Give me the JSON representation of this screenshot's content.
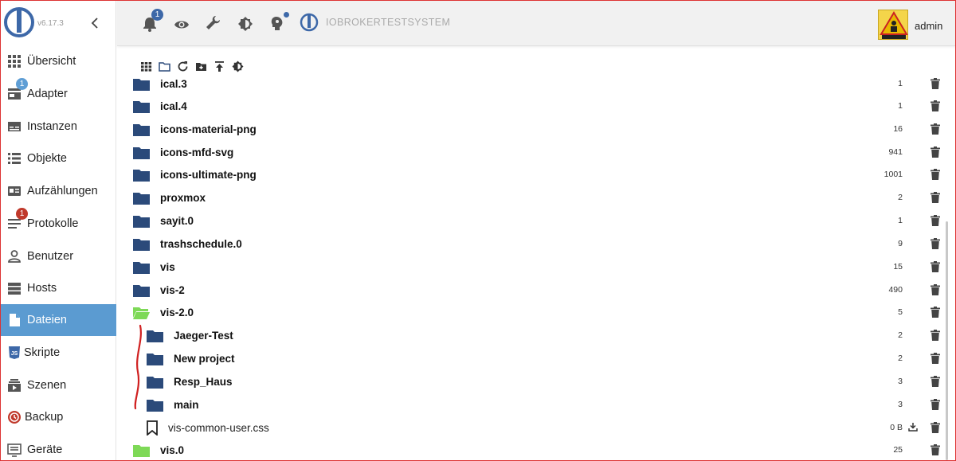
{
  "app": {
    "version": "v6.17.3",
    "system_title": "IOBROKERTESTSYSTEM",
    "user": "admin",
    "notification_count": "1"
  },
  "colors": {
    "accent": "#5b9bd1",
    "folder": "#2b4a7a",
    "folder_open": "#7ed957",
    "badge_blue": "#5f9ed5",
    "badge_red": "#c0392b"
  },
  "sidebar": {
    "items": [
      {
        "label": "Übersicht",
        "icon": "grid-icon"
      },
      {
        "label": "Adapter",
        "icon": "store-icon",
        "badge": "1"
      },
      {
        "label": "Instanzen",
        "icon": "instances-icon"
      },
      {
        "label": "Objekte",
        "icon": "list-icon"
      },
      {
        "label": "Aufzählungen",
        "icon": "enum-icon"
      },
      {
        "label": "Protokolle",
        "icon": "log-icon",
        "badge": "1"
      },
      {
        "label": "Benutzer",
        "icon": "user-icon"
      },
      {
        "label": "Hosts",
        "icon": "server-icon"
      },
      {
        "label": "Dateien",
        "icon": "file-icon",
        "active": true
      },
      {
        "label": "Skripte",
        "icon": "js-icon"
      },
      {
        "label": "Szenen",
        "icon": "scenes-icon"
      },
      {
        "label": "Backup",
        "icon": "backup-icon"
      },
      {
        "label": "Geräte",
        "icon": "devices-icon"
      }
    ]
  },
  "files": [
    {
      "name": "ical.3",
      "count": "1"
    },
    {
      "name": "ical.4",
      "count": "1"
    },
    {
      "name": "icons-material-png",
      "count": "16"
    },
    {
      "name": "icons-mfd-svg",
      "count": "941"
    },
    {
      "name": "icons-ultimate-png",
      "count": "1001"
    },
    {
      "name": "proxmox",
      "count": "2"
    },
    {
      "name": "sayit.0",
      "count": "1"
    },
    {
      "name": "trashschedule.0",
      "count": "9"
    },
    {
      "name": "vis",
      "count": "15"
    },
    {
      "name": "vis-2",
      "count": "490"
    },
    {
      "name": "vis-2.0",
      "count": "5"
    },
    {
      "name": "Jaeger-Test",
      "count": "2"
    },
    {
      "name": "New project",
      "count": "2"
    },
    {
      "name": "Resp_Haus",
      "count": "3"
    },
    {
      "name": "main",
      "count": "3"
    },
    {
      "name": "vis-common-user.css",
      "count": "0 B"
    },
    {
      "name": "vis.0",
      "count": "25"
    }
  ]
}
